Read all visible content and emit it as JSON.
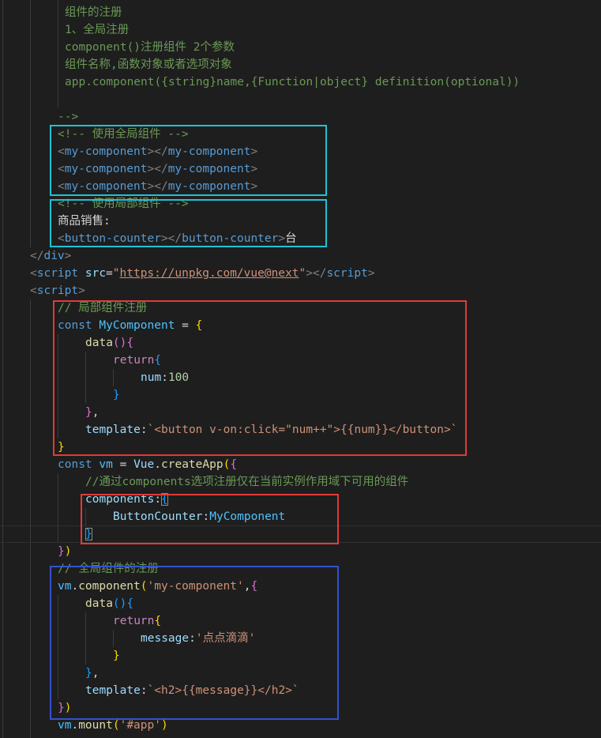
{
  "code": {
    "lines": [
      [
        "组件的注册"
      ],
      [
        "1、全局注册"
      ],
      [
        "component()注册组件 2个参数"
      ],
      [
        "组件名称,函数对象或者选项对象"
      ],
      [
        "app.component({string}name,{Function|object} definition(optional))"
      ],
      [],
      [
        "-->"
      ],
      [
        "<!-- 使用全局组件 -->"
      ],
      [
        "<",
        "my-component",
        "></",
        "my-component",
        ">"
      ],
      [
        "<",
        "my-component",
        "></",
        "my-component",
        ">"
      ],
      [
        "<",
        "my-component",
        "></",
        "my-component",
        ">"
      ],
      [
        "<!-- 使用局部组件 -->"
      ],
      [
        "商品销售:"
      ],
      [
        "<",
        "button-counter",
        "></",
        "button-counter",
        ">",
        "台"
      ],
      [
        "</",
        "div",
        ">"
      ],
      [
        "<",
        "script",
        " src",
        "=",
        "\"",
        "https://unpkg.com/vue@next",
        "\"",
        "></",
        "script",
        ">"
      ],
      [
        "<",
        "script",
        ">"
      ],
      [
        "// 局部组件注册"
      ],
      [
        "const ",
        "MyComponent",
        " = ",
        "{"
      ],
      [
        "data",
        "()",
        "{"
      ],
      [
        "return",
        "{"
      ],
      [
        "num",
        ":",
        "100"
      ],
      [
        "}"
      ],
      [
        "}",
        ","
      ],
      [
        "template",
        ":",
        "`<button v-on:click=\"num++\">{{num}}</button>`"
      ],
      [
        "}"
      ],
      [
        "const ",
        "vm",
        " = ",
        "Vue",
        ".",
        "createApp",
        "(",
        "{"
      ],
      [
        "//通过components选项注册仅在当前实例作用域下可用的组件"
      ],
      [
        "components",
        ":",
        "{"
      ],
      [
        "ButtonCounter",
        ":",
        "MyComponent"
      ],
      [
        "}"
      ],
      [
        "}",
        ")"
      ],
      [
        "// 全局组件的注册"
      ],
      [
        "vm",
        ".",
        "component",
        "(",
        "'my-component'",
        ",",
        "{"
      ],
      [
        "data",
        "()",
        "{"
      ],
      [
        "return",
        "{"
      ],
      [
        "message",
        ":",
        "'点点滴滴'"
      ],
      [
        "}"
      ],
      [
        "}",
        ","
      ],
      [
        "template",
        ":",
        "`<h2>{{message}}</h2>`"
      ],
      [
        "}",
        ")"
      ],
      [
        "vm",
        ".",
        "mount",
        "(",
        "'#app'",
        ")"
      ]
    ]
  },
  "annotations": {
    "cyan": "#20c2d4",
    "red": "#e23a3a",
    "blue": "#3452cc"
  }
}
